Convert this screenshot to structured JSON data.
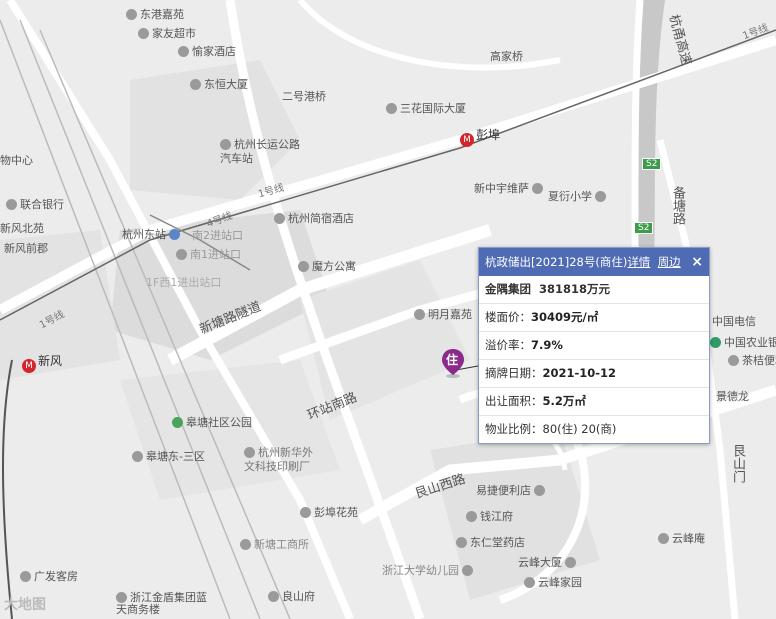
{
  "popup": {
    "title": "杭政储出[2021]28号(商住)",
    "detail_link": "详情",
    "nearby_link": "周边",
    "close_icon": "×",
    "company": "金隅集团",
    "price": "381818万元",
    "floor_price_label": "楼面价：",
    "floor_price": "30409元/㎡",
    "premium_label": "溢价率：",
    "premium": "7.9%",
    "date_label": "摘牌日期：",
    "date": "2021-10-12",
    "area_label": "出让面积：",
    "area": "5.2万㎡",
    "ratio_label": "物业比例：",
    "ratio": "80(住)  20(商)"
  },
  "marker": {
    "label": "住",
    "color": "#8b2a8c"
  },
  "metro": {
    "pengbu": "彭埠",
    "xinfeng": "新风",
    "line_icon": "M"
  },
  "roads": {
    "hangnan": "杭甬高速",
    "gedang": "备塘路",
    "xintang_tunnel": "新塘路隧道",
    "huanzhan_south": "环站南路",
    "genshan_west": "艮山西路",
    "genshan_west_2": "艮山门",
    "erhao_gang": "二号港桥",
    "line1": "1号线",
    "line1b": "1号线",
    "line1c": "1号线",
    "line4": "4号线",
    "line1d": "1号线",
    "s2a": "S2",
    "s2b": "S2"
  },
  "pois": [
    {
      "name": "东港嘉苑"
    },
    {
      "name": "家友超市"
    },
    {
      "name": "愉家酒店"
    },
    {
      "name": "东恒大厦"
    },
    {
      "name": "二号港桥"
    },
    {
      "name": "三花国际大厦"
    },
    {
      "name": "高家桥"
    },
    {
      "name": "杭州长运公路汽车站"
    },
    {
      "name": "杭州简宿酒店"
    },
    {
      "name": "新中宇维萨"
    },
    {
      "name": "夏衍小学"
    },
    {
      "name": "杭州东站"
    },
    {
      "name": "南2进站口"
    },
    {
      "name": "南1进站口"
    },
    {
      "name": "1F西1进出站口"
    },
    {
      "name": "魔方公寓"
    },
    {
      "name": "明月嘉苑"
    },
    {
      "name": "联合银行"
    },
    {
      "name": "新风北苑"
    },
    {
      "name": "新风前郡"
    },
    {
      "name": "物中心"
    },
    {
      "name": "中国电信"
    },
    {
      "name": "中国农业银行"
    },
    {
      "name": "茶桔便利"
    },
    {
      "name": "景德龙"
    },
    {
      "name": "皋塘社区公园"
    },
    {
      "name": "杭州新华外文科技印刷厂"
    },
    {
      "name": "皋塘东-三区"
    },
    {
      "name": "易捷便利店"
    },
    {
      "name": "钱江府"
    },
    {
      "name": "东仁堂药店"
    },
    {
      "name": "彭埠花苑"
    },
    {
      "name": "新塘工商所"
    },
    {
      "name": "云峰大厦"
    },
    {
      "name": "云峰家园"
    },
    {
      "name": "云峰庵"
    },
    {
      "name": "浙江大学幼儿园"
    },
    {
      "name": "广发客房"
    },
    {
      "name": "良山府"
    },
    {
      "name": "浙江金盾集团蓝天商务楼"
    },
    {
      "name": "新苑"
    },
    {
      "name": "新风苑"
    },
    {
      "name": "新风"
    },
    {
      "name": "杭州市"
    }
  ],
  "logo": "大地图"
}
